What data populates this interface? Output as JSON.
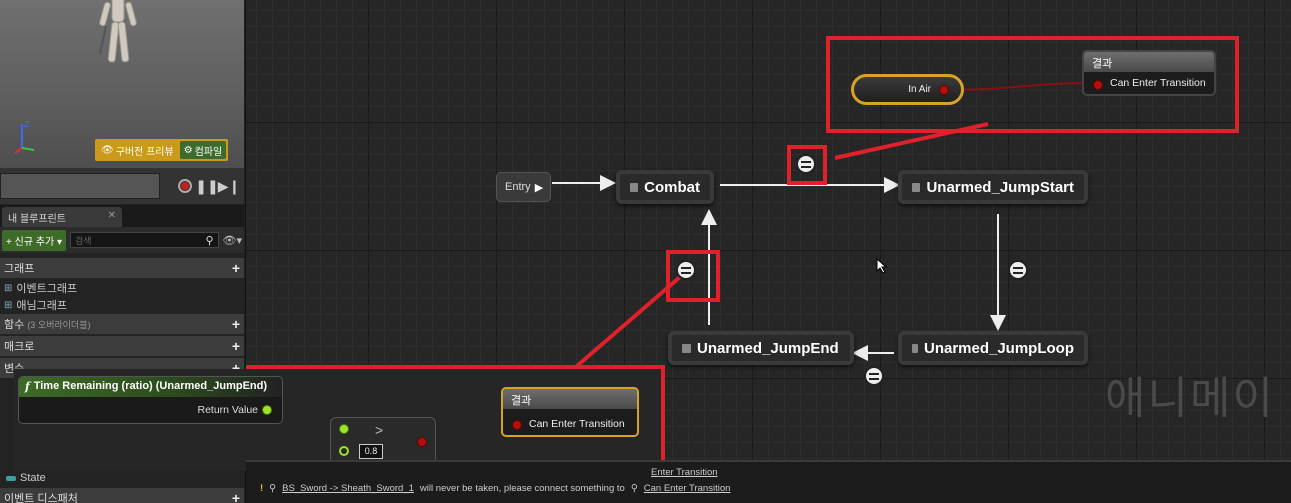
{
  "viewport": {
    "preview_button": "구버전 프리뷰",
    "compile_button": "컴파일"
  },
  "blueprint_panel": {
    "tab_label": "내 블루프린트",
    "add_button": "신규 추가",
    "search_placeholder": "검색",
    "sections": {
      "graphs": "그래프",
      "functions": "함수",
      "functions_sub": "(3 오버라이더블)",
      "macros": "매크로",
      "variables": "변수",
      "event_dispatchers": "이벤트 디스패처"
    },
    "items": {
      "event_graph": "이벤트그래프",
      "anim_graph": "애님그래프",
      "state": "State"
    }
  },
  "graph": {
    "watermark": "애니메이",
    "entry_label": "Entry",
    "states": {
      "combat": "Combat",
      "jump_start": "Unarmed_JumpStart",
      "jump_loop": "Unarmed_JumpLoop",
      "jump_end": "Unarmed_JumpEnd"
    },
    "top_rule": {
      "in_air": "In Air",
      "result_header": "결과",
      "result_body": "Can Enter Transition"
    },
    "bottom_rule": {
      "function_title": "Time Remaining (ratio) (Unarmed_JumpEnd)",
      "return_value": "Return Value",
      "compare_value": "0.8",
      "result_header": "결과",
      "result_body": "Can Enter Transition"
    }
  },
  "output_log": {
    "line1_tail": "Enter Transition",
    "line2_warn": "!",
    "line2_link": "BS_Sword -> Sheath_Sword_1",
    "line2_text": "will never be taken, please connect something to",
    "line2_target": "Can Enter Transition"
  },
  "colors": {
    "highlight_red": "#e0202a",
    "compile_green": "#3e6b28",
    "bool_pin_red": "#b01010",
    "float_pin_green": "#9fe22a"
  }
}
